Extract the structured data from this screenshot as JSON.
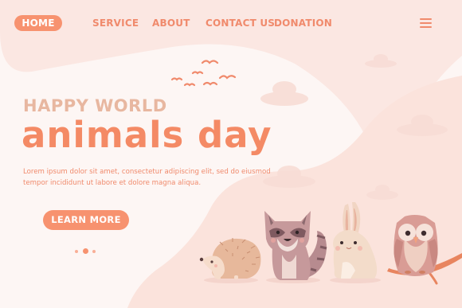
{
  "nav": {
    "items": [
      {
        "label": "HOME",
        "active": true
      },
      {
        "label": "SERVICE"
      },
      {
        "label": "ABOUT"
      },
      {
        "label": "CONTACT US"
      },
      {
        "label": "DONATION"
      }
    ],
    "menu_icon": "hamburger-menu-icon"
  },
  "hero": {
    "subtitle": "HAPPY WORLD",
    "title": "animals day",
    "description": "Lorem ipsum dolor sit amet, consectetur adipiscing elit, sed do eiusmod tempor incididunt ut labore et dolore magna aliqua.",
    "cta_label": "LEARN MORE"
  },
  "carousel": {
    "slides": 3,
    "active_slide": 2
  },
  "illustration": {
    "animals": [
      "hedgehog",
      "raccoon",
      "rabbit",
      "owl"
    ],
    "birds": 6
  },
  "colors": {
    "accent": "#f7926f",
    "text_accent": "#f08a6c",
    "subtitle": "#e8b7a0",
    "background": "#fdf6f4",
    "blob": "#fde9e4"
  }
}
